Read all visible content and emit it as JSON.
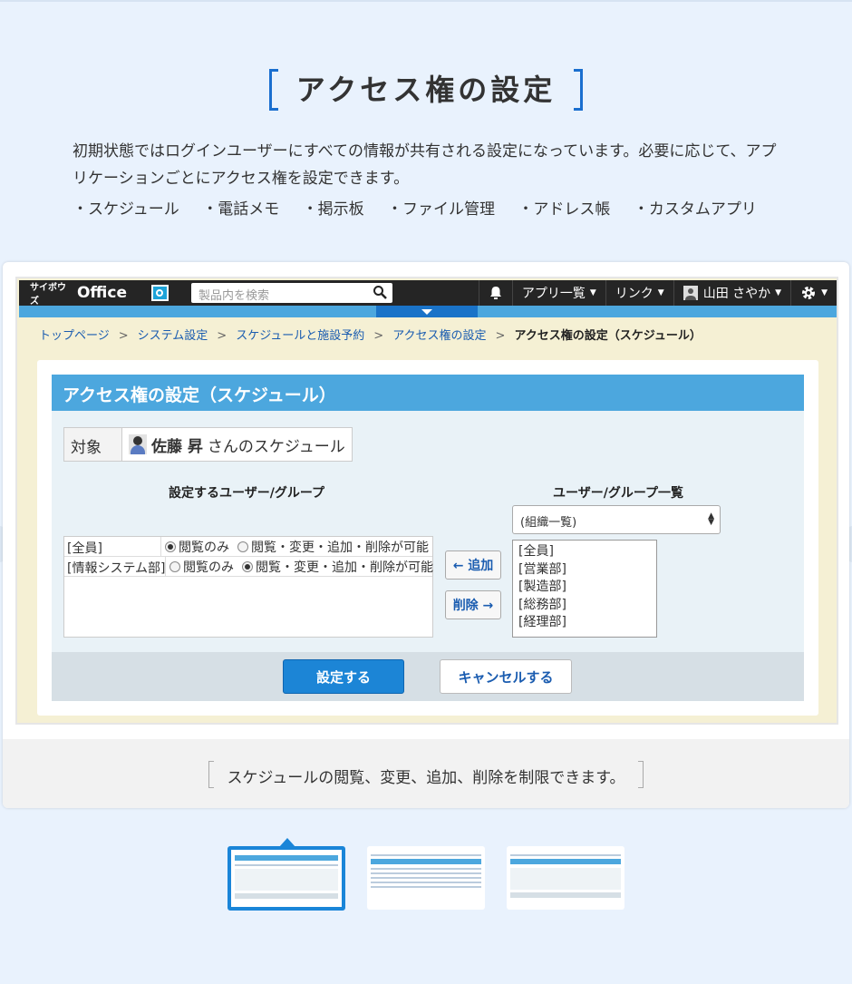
{
  "heading": "アクセス権の設定",
  "intro": "初期状態ではログインユーザーにすべての情報が共有される設定になっています。必要に応じて、アプリケーションごとにアクセス権を設定できます。",
  "features": [
    "・スケジュール",
    "・電話メモ",
    "・掲示板",
    "・ファイル管理",
    "・アドレス帳",
    "・カスタムアプリ"
  ],
  "app": {
    "logo_small": "サイボウズ",
    "logo_big": "Office",
    "search_placeholder": "製品内を検索",
    "nav": {
      "apps": "アプリ一覧",
      "links": "リンク",
      "user": "山田 さやか"
    },
    "breadcrumb": [
      "トップページ",
      "システム設定",
      "スケジュールと施設予約",
      "アクセス権の設定"
    ],
    "breadcrumb_current": "アクセス権の設定（スケジュール）",
    "panel_title": "アクセス権の設定（スケジュール）",
    "target_label": "対象",
    "target_name": "佐藤 昇",
    "target_suffix": "さんのスケジュール",
    "set_users_heading": "設定するユーザー/グループ",
    "user_list_heading": "ユーザー/グループ一覧",
    "rows": [
      {
        "name": "[全員]",
        "opt1": "閲覧のみ",
        "opt2": "閲覧・変更・追加・削除が可能",
        "selected": 1
      },
      {
        "name": "[情報システム部]",
        "opt1": "閲覧のみ",
        "opt2": "閲覧・変更・追加・削除が可能",
        "selected": 2
      }
    ],
    "add_button": "← 追加",
    "remove_button": "削除 →",
    "select_value": "(組織一覧)",
    "list_items": [
      "[全員]",
      "[営業部]",
      "[製造部]",
      "[総務部]",
      "[経理部]"
    ],
    "submit": "設定する",
    "cancel": "キャンセルする"
  },
  "caption": "スケジュールの閲覧、変更、追加、削除を制限できます。",
  "colors": {
    "accent": "#1a6fcf",
    "panel_blue": "#4ca7de",
    "nav_dark": "#252525"
  }
}
